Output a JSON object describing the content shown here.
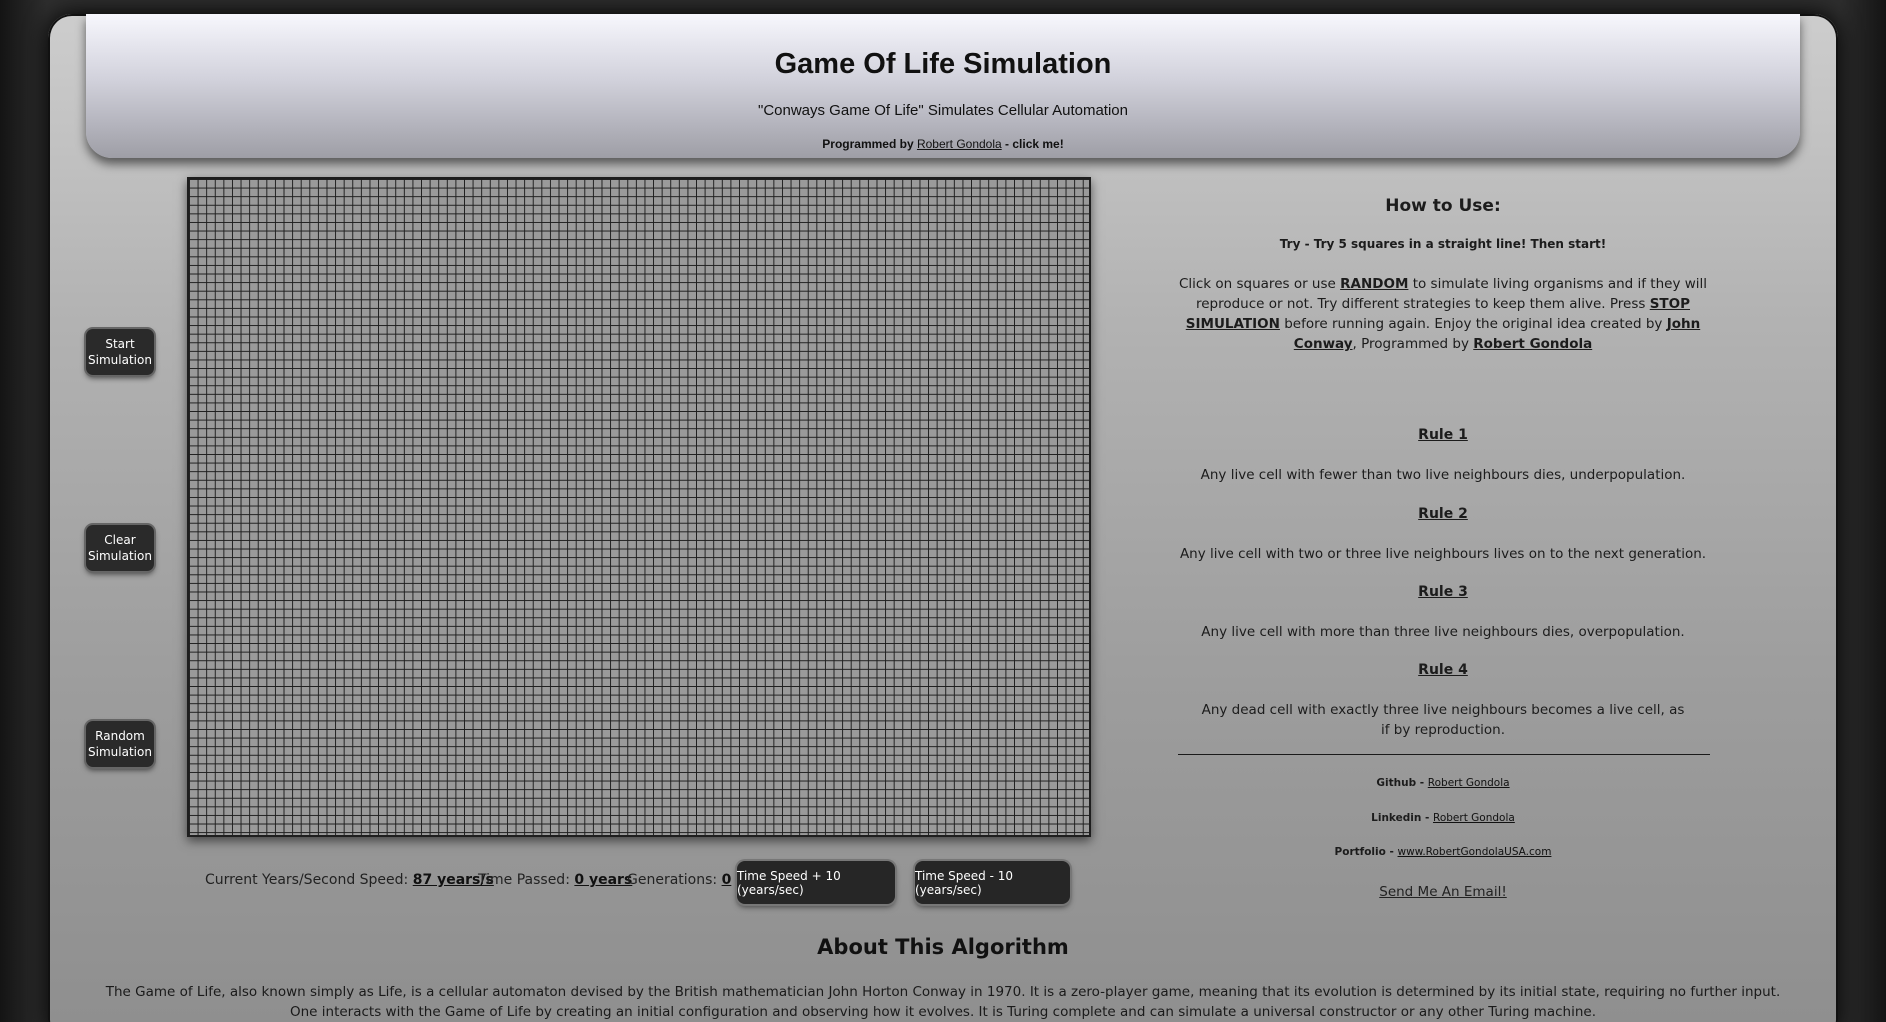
{
  "header": {
    "title": "Game Of Life Simulation",
    "subtitle": "\"Conways Game Of Life\" Simulates Cellular Automation",
    "byline_prefix": "Programmed by",
    "byline_link": "Robert Gondola",
    "byline_suffix": " - click me!"
  },
  "controls": {
    "start": "Start Simulation",
    "clear": "Clear Simulation",
    "random": "Random Simulation"
  },
  "stats": {
    "speed_label": "Current Years/Second Speed:",
    "speed_value": "87 years/s",
    "time_label": "Time Passed:",
    "time_value": "0 years",
    "gen_label": "Generations:",
    "gen_value": "0",
    "speed_up": "Time Speed + 10 (years/sec)",
    "speed_down": "Time Speed - 10 (years/sec)"
  },
  "howto": {
    "title": "How to Use:",
    "try": "Try - Try 5 squares in a straight line! Then start!",
    "p1": "Click on squares or use",
    "random_link": "RANDOM",
    "p2": "to simulate living organisms and if they will reproduce or not. Try different strategies to keep them alive. Press",
    "stop_link": "STOP SIMULATION",
    "p3": "before running again. Enjoy the original idea created by",
    "conway_link": "John Conway",
    "p4": ", Programmed by",
    "author_link": "Robert Gondola"
  },
  "rules": [
    {
      "title": "Rule 1",
      "text": "Any live cell with fewer than two live neighbours dies, underpopulation."
    },
    {
      "title": "Rule 2",
      "text": "Any live cell with two or three live neighbours lives on to the next generation."
    },
    {
      "title": "Rule 3",
      "text": "Any live cell with more than three live neighbours dies, overpopulation."
    },
    {
      "title": "Rule 4",
      "text": "Any dead cell with exactly three live neighbours becomes a live cell, as if by reproduction."
    }
  ],
  "links": {
    "github_label": "Github -",
    "github_value": "Robert Gondola",
    "linkedin_label": "Linkedin -",
    "linkedin_value": "Robert Gondola",
    "portfolio_label": "Portfolio -",
    "portfolio_value": "www.RobertGondolaUSA.com",
    "email": "Send Me An Email!"
  },
  "about": {
    "title": "About This Algorithm",
    "text": "The Game of Life, also known simply as Life, is a cellular automaton devised by the British mathematician John Horton Conway in 1970. It is a zero-player game, meaning that its evolution is determined by its initial state, requiring no further input. One interacts with the Game of Life by creating an initial configuration and observing how it evolves. It is Turing complete and can simulate a universal constructor or any other Turing machine."
  }
}
